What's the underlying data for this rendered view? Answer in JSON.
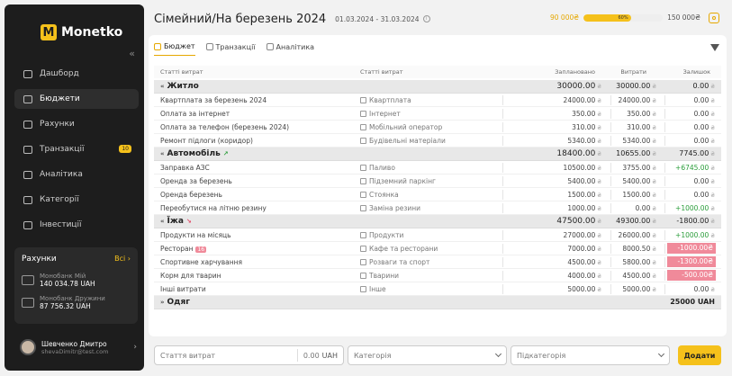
{
  "brand": {
    "name": "Monetko",
    "mark": "M"
  },
  "sidebar": {
    "items": [
      {
        "label": "Дашборд",
        "active": false
      },
      {
        "label": "Бюджети",
        "active": true
      },
      {
        "label": "Рахунки",
        "active": false
      },
      {
        "label": "Транзакції",
        "active": false,
        "badge": "10"
      },
      {
        "label": "Аналітика",
        "active": false
      },
      {
        "label": "Категорії",
        "active": false
      },
      {
        "label": "Інвестиції",
        "active": false
      }
    ],
    "accounts": {
      "title": "Рахунки",
      "all_label": "Всі",
      "list": [
        {
          "name": "Монобанк Мій",
          "amount": "140 034.78 UAH"
        },
        {
          "name": "Монобанк Дружини",
          "amount": "87 756.32 UAH"
        }
      ]
    },
    "user": {
      "name": "Шевченко Дмитро",
      "email": "shevaDimitr@test.com"
    }
  },
  "header": {
    "title": "Сімейний/На березень 2024",
    "date_range": "01.03.2024 - 31.03.2024",
    "spent": "90 000₴",
    "progress_label": "60%",
    "progress": 0.6,
    "total": "150 000₴"
  },
  "tabs": [
    {
      "label": "Бюджет",
      "active": true
    },
    {
      "label": "Транзакції",
      "active": false
    },
    {
      "label": "Аналітика",
      "active": false
    }
  ],
  "table": {
    "headers": {
      "item": "Статті витрат",
      "category": "Статті витрат",
      "planned": "Заплановано",
      "spent": "Витрати",
      "left": "Залишок"
    },
    "currency": "₴",
    "groups": [
      {
        "name": "Житло",
        "planned": "30000.00",
        "spent": "30000.00",
        "left": "0.00",
        "rows": [
          {
            "name": "Квартплата за березень 2024",
            "cat": "Квартплата",
            "planned": "24000.00",
            "spent": "24000.00",
            "left": "0.00"
          },
          {
            "name": "Оплата за інтернет",
            "cat": "Інтернет",
            "planned": "350.00",
            "spent": "350.00",
            "left": "0.00"
          },
          {
            "name": "Оплата за телефон (березень 2024)",
            "cat": "Мобільний оператор",
            "planned": "310.00",
            "spent": "310.00",
            "left": "0.00"
          },
          {
            "name": "Ремонт підлоги (коридор)",
            "cat": "Будівельні матеріали",
            "planned": "5340.00",
            "spent": "5340.00",
            "left": "0.00"
          }
        ]
      },
      {
        "name": "Автомобіль",
        "trend": "↗",
        "planned": "18400.00",
        "spent": "10655.00",
        "left": "7745.00",
        "rows": [
          {
            "name": "Заправка АЗС",
            "cat": "Паливо",
            "planned": "10500.00",
            "spent": "3755.00",
            "left": "+6745.00",
            "pos": true
          },
          {
            "name": "Оренда за березень",
            "cat": "Підземний паркінг",
            "planned": "5400.00",
            "spent": "5400.00",
            "left": "0.00"
          },
          {
            "name": "Оренда березень",
            "cat": "Стоянка",
            "planned": "1500.00",
            "spent": "1500.00",
            "left": "0.00"
          },
          {
            "name": "Переобутися на літню резину",
            "cat": "Заміна резини",
            "planned": "1000.00",
            "spent": "0.00",
            "left": "+1000.00",
            "pos": true
          }
        ]
      },
      {
        "name": "Їжа",
        "trend": "↘",
        "planned": "47500.00",
        "spent": "49300.00",
        "left": "-1800.00",
        "rows": [
          {
            "name": "Продукти на місяць",
            "cat": "Продукти",
            "planned": "27000.00",
            "spent": "26000.00",
            "left": "+1000.00",
            "pos": true
          },
          {
            "name": "Ресторан",
            "tag": "16",
            "cat": "Кафе та ресторани",
            "planned": "7000.00",
            "spent": "8000.50",
            "left": "-1000.00",
            "neg": true
          },
          {
            "name": "Спортивне харчування",
            "cat": "Розваги та спорт",
            "planned": "4500.00",
            "spent": "5800.00",
            "left": "-1300.00",
            "neg": true
          },
          {
            "name": "Корм для тварин",
            "cat": "Тварини",
            "planned": "4000.00",
            "spent": "4500.00",
            "left": "-500.00",
            "neg": true
          },
          {
            "name": "Інші витрати",
            "cat": "Інше",
            "planned": "5000.00",
            "spent": "5000.00",
            "left": "0.00"
          }
        ]
      },
      {
        "name": "Одяг",
        "planned": "",
        "spent": "",
        "left": "25000 UAH",
        "rows": []
      }
    ]
  },
  "footer": {
    "item_placeholder": "Стаття витрат",
    "amount": "0.00",
    "currency_code": "UAH",
    "category_placeholder": "Категорія",
    "subcategory_placeholder": "Підкатегорія",
    "add_label": "Додати"
  }
}
